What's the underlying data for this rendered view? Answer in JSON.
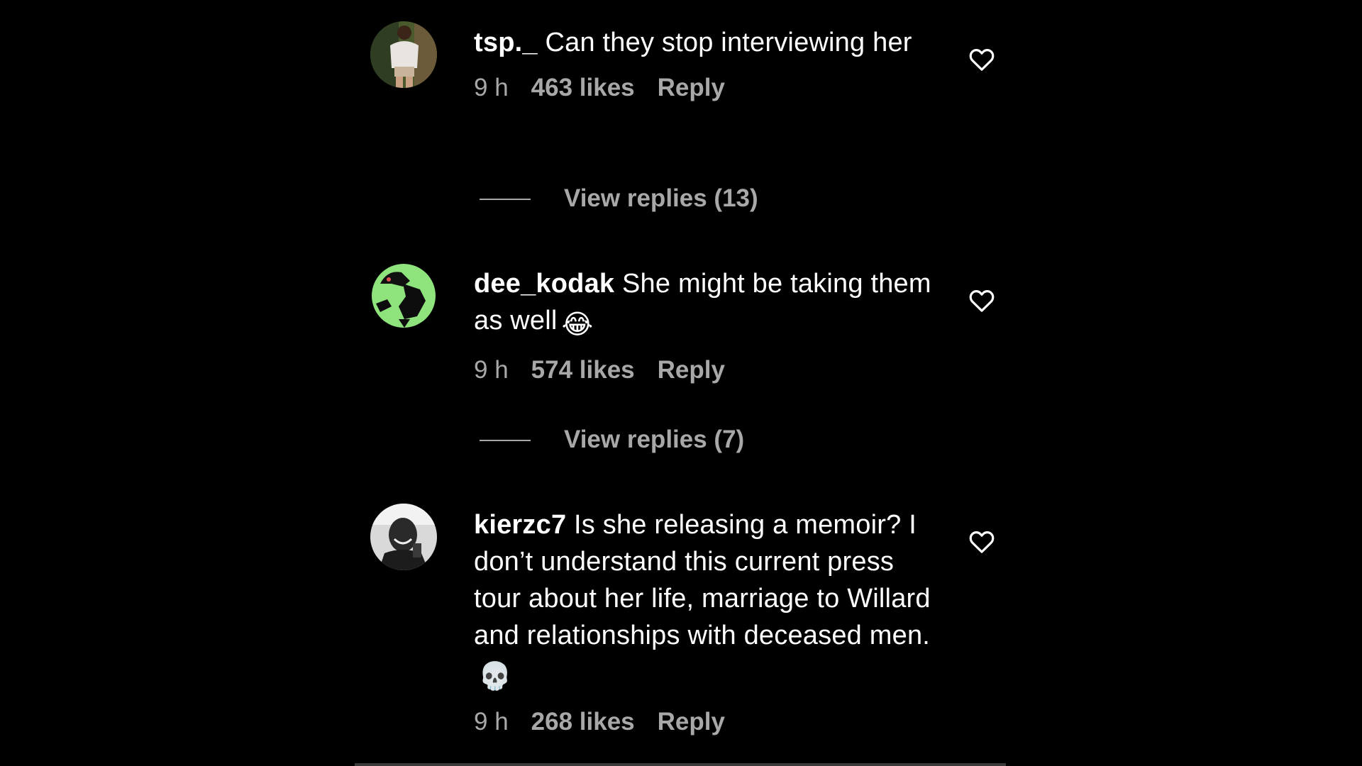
{
  "colors": {
    "background": "#000000",
    "primary_text": "#ffffff",
    "secondary_text": "#a8a8a8"
  },
  "comments": [
    {
      "username": "tsp._",
      "text": "Can they stop interviewing her",
      "emoji": "",
      "time": "9 h",
      "likes": "463 likes",
      "reply_label": "Reply",
      "view_replies": "View replies (13)",
      "like_icon": "heart-outline-icon"
    },
    {
      "username": "dee_kodak",
      "text": "She might be taking them as well",
      "emoji": "😂",
      "time": "9 h",
      "likes": "574 likes",
      "reply_label": "Reply",
      "view_replies": "View replies (7)",
      "like_icon": "heart-outline-icon"
    },
    {
      "username": "kierzc7",
      "text": "Is she releasing a memoir? I don’t understand this current press tour about her life, marriage to Willard and relationships with deceased men.",
      "emoji": "💀",
      "time": "9 h",
      "likes": "268 likes",
      "reply_label": "Reply",
      "like_icon": "heart-outline-icon"
    }
  ]
}
